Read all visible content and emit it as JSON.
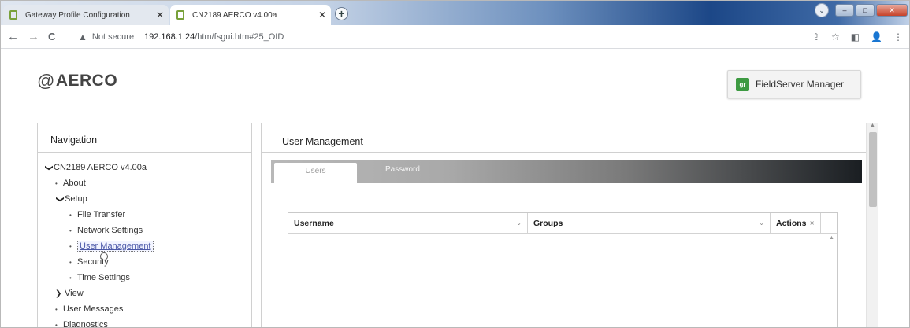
{
  "browser": {
    "tabs": [
      {
        "title": "Gateway Profile Configuration",
        "close": "✕"
      },
      {
        "title": "CN2189 AERCO v4.00a",
        "close": "✕"
      }
    ],
    "new_tab": "+",
    "window": {
      "menu": "⌄",
      "minimize": "–",
      "maximize": "□",
      "close": "✕"
    },
    "address": {
      "back": "←",
      "forward": "→",
      "reload": "C",
      "security_icon": "▲",
      "security": "Not secure",
      "url_host": "192.168.1.24",
      "url_path": "/htm/fsgui.htm#25_OID"
    },
    "toolbar_icons": {
      "share": "⇪",
      "star": "☆",
      "sidebar": "◧",
      "profile": "👤",
      "menu": "⋮"
    }
  },
  "page": {
    "logo": {
      "mark": "@",
      "text": "AERCO"
    },
    "fieldserver_manager": {
      "badge": "gr",
      "label": "FieldServer Manager"
    }
  },
  "navigation": {
    "title": "Navigation",
    "items": [
      {
        "label": "CN2189 AERCO v4.00a",
        "marker": "❯",
        "expanded": true
      },
      {
        "label": "About",
        "marker": "•"
      },
      {
        "label": "Setup",
        "marker": "❯",
        "expanded": true
      },
      {
        "label": "File Transfer",
        "marker": "•"
      },
      {
        "label": "Network Settings",
        "marker": "•"
      },
      {
        "label": "User Management",
        "marker": "•",
        "selected": true
      },
      {
        "label": "Security",
        "marker": "•"
      },
      {
        "label": "Time Settings",
        "marker": "•"
      },
      {
        "label": "View",
        "marker": "❯",
        "expanded": false
      },
      {
        "label": "User Messages",
        "marker": "•"
      },
      {
        "label": "Diagnostics",
        "marker": "•"
      }
    ]
  },
  "main": {
    "title": "User Management",
    "tabs": [
      {
        "label": "Users",
        "active": true
      },
      {
        "label": "Password",
        "active": false
      }
    ],
    "table": {
      "columns": [
        {
          "label": "Username",
          "sort": "⌄"
        },
        {
          "label": "Groups",
          "sort": "⌄"
        },
        {
          "label": "Actions",
          "sort": "⨯"
        }
      ],
      "rows": []
    }
  },
  "colors": {
    "accent_green": "#3d9a42",
    "selected_link": "#4b58a8"
  }
}
